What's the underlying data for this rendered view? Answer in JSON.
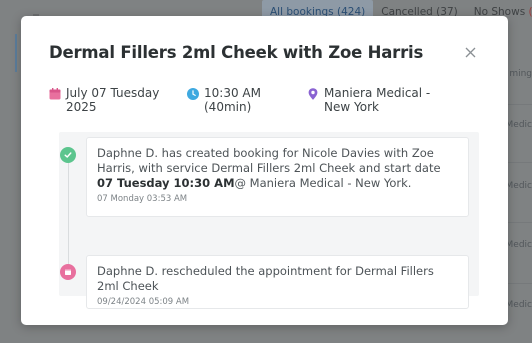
{
  "background": {
    "tabs": [
      {
        "label": "All bookings (424)",
        "active": true
      },
      {
        "label": "Cancelled (37)",
        "active": false
      },
      {
        "label": "No Shows",
        "active": false
      }
    ],
    "no_shows_badge": "(",
    "right_column": [
      "ming",
      "Medic",
      "Medic",
      "Medic",
      "Medic",
      "Medic"
    ]
  },
  "modal": {
    "title": "Dermal Fillers 2ml Cheek with Zoe Harris",
    "date": "July 07 Tuesday 2025",
    "time": "10:30 AM (40min)",
    "location": "Maniera Medical - New York"
  },
  "timeline": [
    {
      "text_before": "Daphne D. has created booking for Nicole Davies with Zoe Harris, with service Dermal Fillers 2ml Cheek and start date ",
      "text_bold": "07 Tuesday 10:30 AM",
      "text_after": "@ Maniera Medical - New York.",
      "timestamp": "07 Monday 03:53 AM",
      "icon": "check-icon",
      "color": "#5cc58e"
    },
    {
      "text_before": "Daphne D. rescheduled the appointment for Dermal Fillers 2ml Cheek",
      "text_bold": "",
      "text_after": "",
      "timestamp": "09/24/2024 05:09 AM",
      "icon": "calendar-icon",
      "color": "#e8709e"
    }
  ],
  "colors": {
    "calendar_icon": "#e8709e",
    "clock_icon": "#3fa9e0",
    "location_icon": "#8a63d2"
  }
}
